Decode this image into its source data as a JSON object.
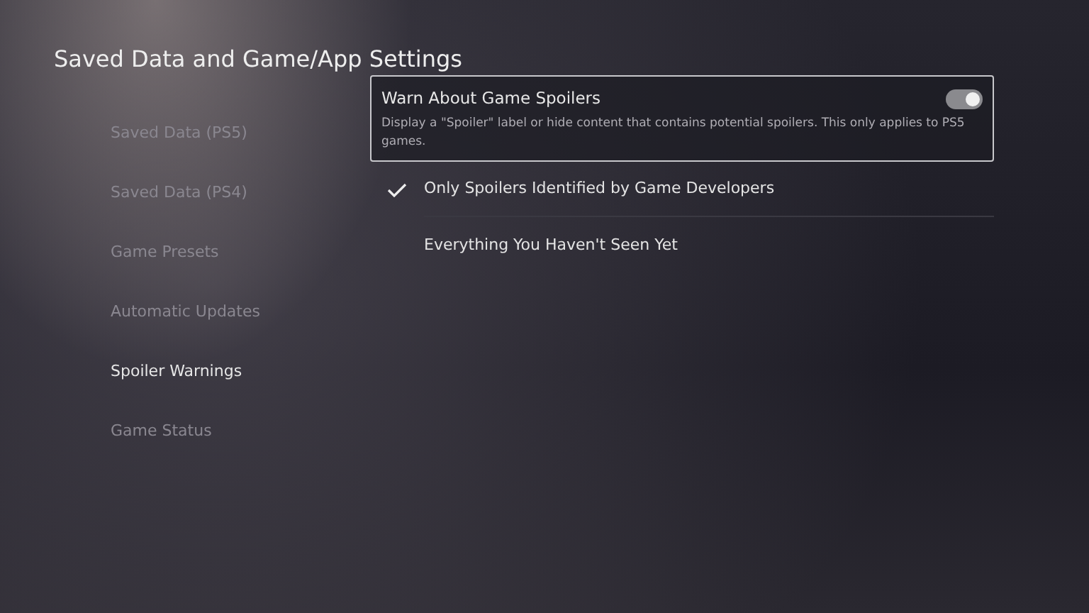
{
  "title": "Saved Data and Game/App Settings",
  "sidebar": {
    "items": [
      {
        "label": "Saved Data (PS5)",
        "selected": false
      },
      {
        "label": "Saved Data (PS4)",
        "selected": false
      },
      {
        "label": "Game Presets",
        "selected": false
      },
      {
        "label": "Automatic Updates",
        "selected": false
      },
      {
        "label": "Spoiler Warnings",
        "selected": true
      },
      {
        "label": "Game Status",
        "selected": false
      }
    ]
  },
  "setting": {
    "label": "Warn About Game Spoilers",
    "description": "Display a \"Spoiler\" label or hide content that contains potential spoilers. This only applies to PS5 games.",
    "on": true
  },
  "options": [
    {
      "label": "Only Spoilers Identified by Game Developers",
      "selected": true
    },
    {
      "label": "Everything You Haven't Seen Yet",
      "selected": false
    }
  ]
}
